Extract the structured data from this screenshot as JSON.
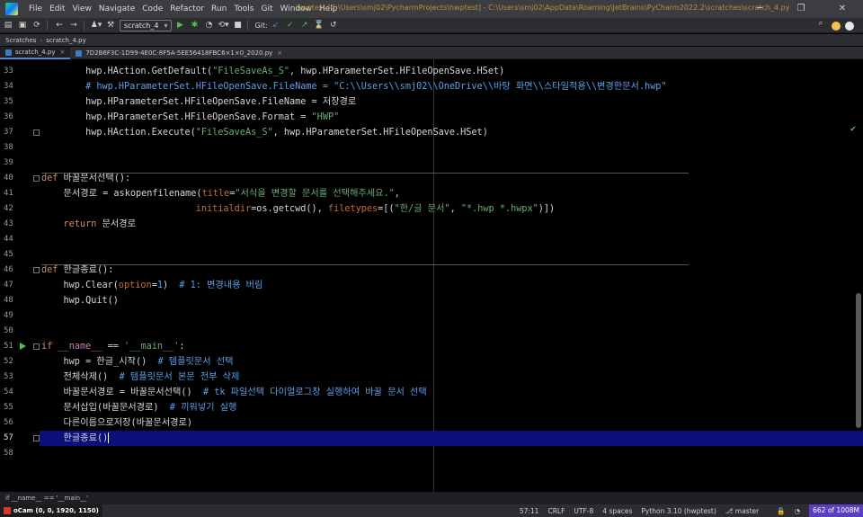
{
  "window": {
    "title": "hwptest [C:\\Users\\smj02\\PycharmProjects\\hwptest] - C:\\Users\\smj02\\AppData\\Roaming\\JetBrains\\PyCharm2022.2\\scratches\\scratch_4.py",
    "minimize": "─",
    "maximize": "❐",
    "close": "✕"
  },
  "menu": [
    "File",
    "Edit",
    "View",
    "Navigate",
    "Code",
    "Refactor",
    "Run",
    "Tools",
    "Git",
    "Window",
    "Help"
  ],
  "toolbar": {
    "run_config": "scratch_4",
    "git_label": "Git:"
  },
  "navbar": {
    "root": "Scratches",
    "file": "scratch_4.py"
  },
  "tabs": [
    {
      "label": "scratch_4.py",
      "active": true
    },
    {
      "label": "7D2B6F3C-1D99-4E0C-8F5A-5EE56418FBC6×1×0_2020.py",
      "active": false
    }
  ],
  "editor": {
    "lines": [
      {
        "num": "33",
        "code": "        hwp.HAction.GetDefault(\"FileSaveAs_S\", hwp.HParameterSet.HFileOpenSave.HSet)"
      },
      {
        "num": "34",
        "code": "        # hwp.HParameterSet.HFileOpenSave.FileName = \"C:\\\\Users\\\\smj02\\\\OneDrive\\\\바탕 화면\\\\스타일적용\\\\변경한문서.hwp\""
      },
      {
        "num": "35",
        "code": "        hwp.HParameterSet.HFileOpenSave.FileName = 저장경로"
      },
      {
        "num": "36",
        "code": "        hwp.HParameterSet.HFileOpenSave.Format = \"HWP\""
      },
      {
        "num": "37",
        "code": "        hwp.HAction.Execute(\"FileSaveAs_S\", hwp.HParameterSet.HFileOpenSave.HSet)"
      },
      {
        "num": "38",
        "code": ""
      },
      {
        "num": "39",
        "code": ""
      },
      {
        "num": "40",
        "code": "def 바꿀문서선택():"
      },
      {
        "num": "41",
        "code": "    문서경로 = askopenfilename(title=\"서식을 변경할 문서를 선택해주세요.\","
      },
      {
        "num": "42",
        "code": "                            initialdir=os.getcwd(), filetypes=[(\"한/글 문서\", \"*.hwp *.hwpx\")])"
      },
      {
        "num": "43",
        "code": "    return 문서경로"
      },
      {
        "num": "44",
        "code": ""
      },
      {
        "num": "45",
        "code": ""
      },
      {
        "num": "46",
        "code": "def 한글종료():"
      },
      {
        "num": "47",
        "code": "    hwp.Clear(option=1)  # 1: 변경내용 버림"
      },
      {
        "num": "48",
        "code": "    hwp.Quit()"
      },
      {
        "num": "49",
        "code": ""
      },
      {
        "num": "50",
        "code": ""
      },
      {
        "num": "51",
        "code": "if __name__ == '__main__':"
      },
      {
        "num": "52",
        "code": "    hwp = 한글_시작()  # 템플릿문서 선택"
      },
      {
        "num": "53",
        "code": "    전체삭제()  # 템플릿문서 본문 전부 삭제"
      },
      {
        "num": "54",
        "code": "    바꿀문서경로 = 바꿀문서선택()  # tk 파일선택 다이얼로그창 실행하여 바꿀 문서 선택"
      },
      {
        "num": "55",
        "code": "    문서삽입(바꿀문서경로)  # 끼워넣기 실행"
      },
      {
        "num": "56",
        "code": "    다른이름으로저장(바꿀문서경로)"
      },
      {
        "num": "57",
        "code": "    한글종료()"
      },
      {
        "num": "58",
        "code": ""
      }
    ],
    "current_line": "57"
  },
  "breadcrumb": "if __name__ == '__main__'",
  "status": {
    "ocam": "oCam (0, 0, 1920, 1150)",
    "position": "57:11",
    "line_sep": "CRLF",
    "encoding": "UTF-8",
    "indent": "4 spaces",
    "interpreter": "Python 3.10 (hwptest)",
    "branch": "master",
    "memory": "662 of 1008M"
  },
  "colors": {
    "title_accent": "#c28d3b",
    "current_line": "#0b0f7a",
    "memory_bar": "#5a3fc0"
  }
}
